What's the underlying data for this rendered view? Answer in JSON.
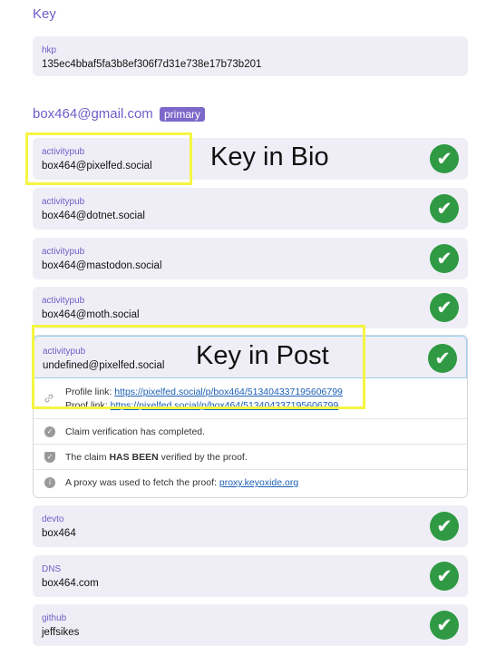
{
  "section_title": "Key",
  "key_card": {
    "protocol": "hkp",
    "fingerprint": "135ec4bbaf5fa3b8ef306f7d31e738e17b73b201"
  },
  "identity": {
    "email": "box464@gmail.com",
    "badge": "primary"
  },
  "claims": [
    {
      "protocol": "activitypub",
      "value": "box464@pixelfed.social",
      "status_icon": "check-icon"
    },
    {
      "protocol": "activitypub",
      "value": "box464@dotnet.social",
      "status_icon": "check-icon"
    },
    {
      "protocol": "activitypub",
      "value": "box464@mastodon.social",
      "status_icon": "check-icon"
    },
    {
      "protocol": "activitypub",
      "value": "box464@moth.social",
      "status_icon": "check-icon"
    }
  ],
  "expanded_claim": {
    "protocol": "activitypub",
    "value": "undefined@pixelfed.social",
    "profile_link_label": "Profile link:",
    "profile_link": "https://pixelfed.social/p/box464/513404337195606799",
    "proof_link_label": "Proof link:",
    "proof_link": "https://pixelfed.social/p/box464/513404337195606799",
    "status_completed": "Claim verification has completed.",
    "status_verified_pre": "The claim ",
    "status_verified_bold": "HAS BEEN",
    "status_verified_post": " verified by the proof.",
    "proxy_text": "A proxy was used to fetch the proof: ",
    "proxy_link": "proxy.keyoxide.org"
  },
  "more_claims": [
    {
      "protocol": "devto",
      "value": "box464"
    },
    {
      "protocol": "DNS",
      "value": "box464.com"
    },
    {
      "protocol": "github",
      "value": "jeffsikes"
    }
  ],
  "annotations": {
    "key_in_bio": "Key in Bio",
    "key_in_post": "Key in Post"
  },
  "check_glyph": "✔"
}
